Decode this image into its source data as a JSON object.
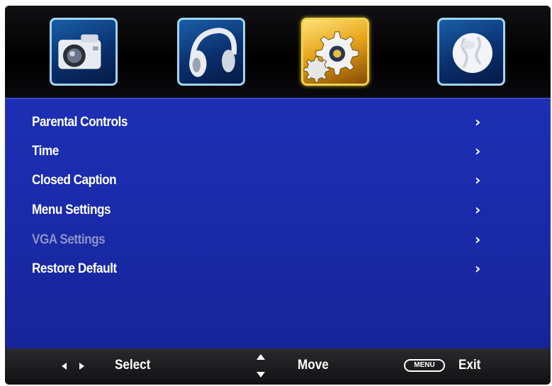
{
  "categories": [
    {
      "name": "picture",
      "icon": "camera-icon",
      "selected": false
    },
    {
      "name": "sound",
      "icon": "headphones-icon",
      "selected": false
    },
    {
      "name": "setup",
      "icon": "gear-icon",
      "selected": true
    },
    {
      "name": "channel",
      "icon": "globe-icon",
      "selected": false
    }
  ],
  "menu": {
    "items": [
      {
        "label": "Parental Controls",
        "enabled": true
      },
      {
        "label": "Time",
        "enabled": true
      },
      {
        "label": "Closed Caption",
        "enabled": true
      },
      {
        "label": "Menu Settings",
        "enabled": true
      },
      {
        "label": "VGA Settings",
        "enabled": false
      },
      {
        "label": "Restore Default",
        "enabled": true
      }
    ],
    "arrow_glyph": "›"
  },
  "help": {
    "select_label": "Select",
    "move_label": "Move",
    "menu_key_label": "MENU",
    "exit_label": "Exit"
  },
  "colors": {
    "menu_background": "#1a2aa8",
    "selected_icon_border": "#f0d34a",
    "icon_border": "#9fd6ef",
    "disabled_text": "#8c93c9"
  }
}
